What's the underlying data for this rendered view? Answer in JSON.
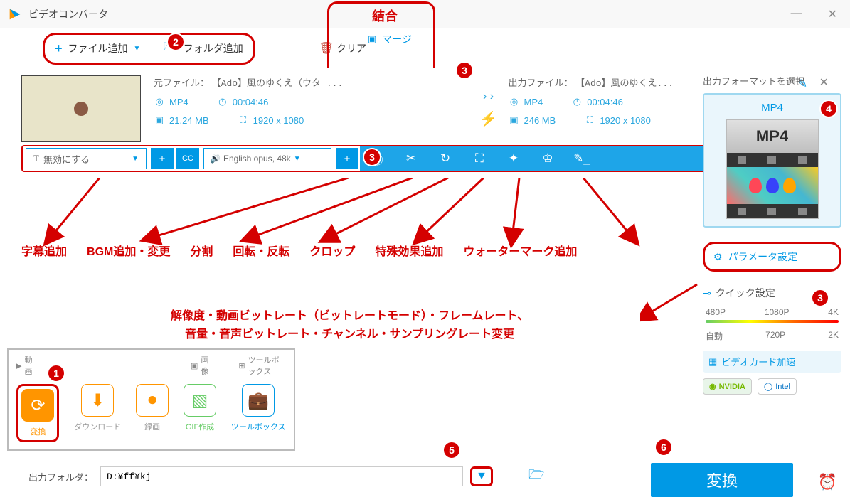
{
  "app": {
    "title": "ビデオコンバータ"
  },
  "toolbar": {
    "add_file": "ファイル追加",
    "add_folder": "フォルダ追加",
    "clear": "クリア",
    "merge": "マージ",
    "combine_label": "結合"
  },
  "file": {
    "source_label_prefix": "元ファイル：",
    "output_label_prefix": "出力ファイル：",
    "source_title": "【Ado】風のゆくえ（ウタ ...",
    "output_title": "【Ado】風のゆくえ...",
    "source": {
      "format": "MP4",
      "duration": "00:04:46",
      "size": "21.24 MB",
      "resolution": "1920 x 1080"
    },
    "output": {
      "format": "MP4",
      "duration": "00:04:46",
      "size": "246 MB",
      "resolution": "1920 x 1080"
    }
  },
  "subtitles": {
    "selected": "無効にする"
  },
  "audio": {
    "selected": "English opus, 48k"
  },
  "annotations": {
    "edit_tools": [
      "字幕追加",
      "BGM追加・変更",
      "分割",
      "回転・反転",
      "クロップ",
      "特殊効果追加",
      "ウォーターマーク追加"
    ],
    "param_line1": "解像度・動画ビットレート（ビットレートモード）・フレームレート、",
    "param_line2": "音量・音声ビットレート・チャンネル・サンプリングレート変更"
  },
  "right": {
    "title": "出力フォーマットを選択",
    "format": "MP4",
    "param_settings": "パラメータ設定",
    "quick_settings": "クイック設定",
    "res_labels": [
      "480P",
      "1080P",
      "4K",
      "自動",
      "720P",
      "2K"
    ],
    "gpu_accel": "ビデオカード加速",
    "nvidia": "NVIDIA",
    "intel": "Intel"
  },
  "modes": {
    "tabs": [
      "動画",
      "画像",
      "ツールボックス"
    ],
    "items": [
      {
        "label": "変換"
      },
      {
        "label": "ダウンロード"
      },
      {
        "label": "録画"
      },
      {
        "label": "GIF作成"
      },
      {
        "label": "ツールボックス"
      }
    ]
  },
  "bottom": {
    "out_folder_label": "出力フォルダ：",
    "out_folder_path": "D:¥ff¥kj",
    "convert": "変換"
  },
  "steps": {
    "s1": "1",
    "s2": "2",
    "s3a": "3",
    "s3b": "3",
    "s3c": "3",
    "s4": "4",
    "s5": "5",
    "s6": "6"
  }
}
